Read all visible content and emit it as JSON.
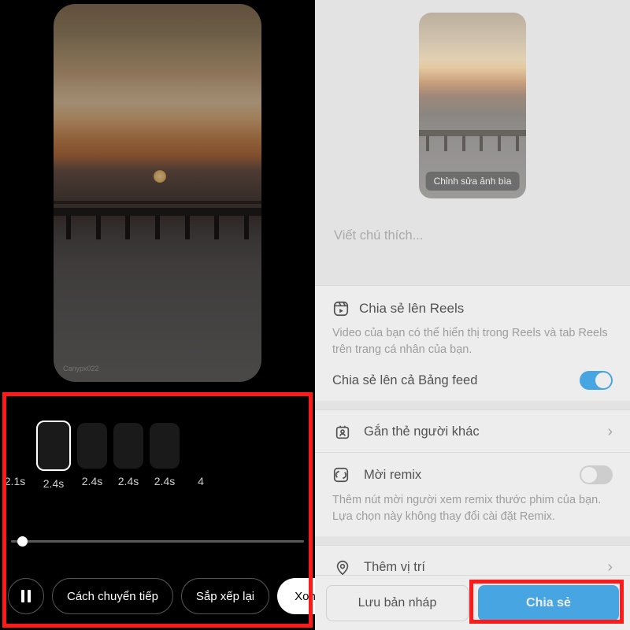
{
  "left": {
    "watermark": "Canypx022",
    "clips": [
      "2.1s",
      "2.4s",
      "2.4s",
      "2.4s",
      "2.4s",
      "4"
    ],
    "selected_index": 1,
    "buttons": {
      "transition": "Cách chuyển tiếp",
      "reorder": "Sắp xếp lại",
      "done": "Xong"
    }
  },
  "right": {
    "cover_edit": "Chỉnh sửa ảnh bìa",
    "caption_placeholder": "Viết chú thích...",
    "reels": {
      "title": "Chia sẻ lên Reels",
      "desc": "Video của bạn có thể hiển thị trong Reels và tab Reels trên trang cá nhân của bạn.",
      "feed_label": "Chia sẻ lên cả Bảng feed"
    },
    "tag_label": "Gắn thẻ người khác",
    "remix": {
      "title": "Mời remix",
      "desc": "Thêm nút mời người xem remix thước phim của bạn. Lựa chọn này không thay đổi cài đặt Remix."
    },
    "location_label": "Thêm vị trí",
    "draft": "Lưu bản nháp",
    "share": "Chia sẻ"
  }
}
